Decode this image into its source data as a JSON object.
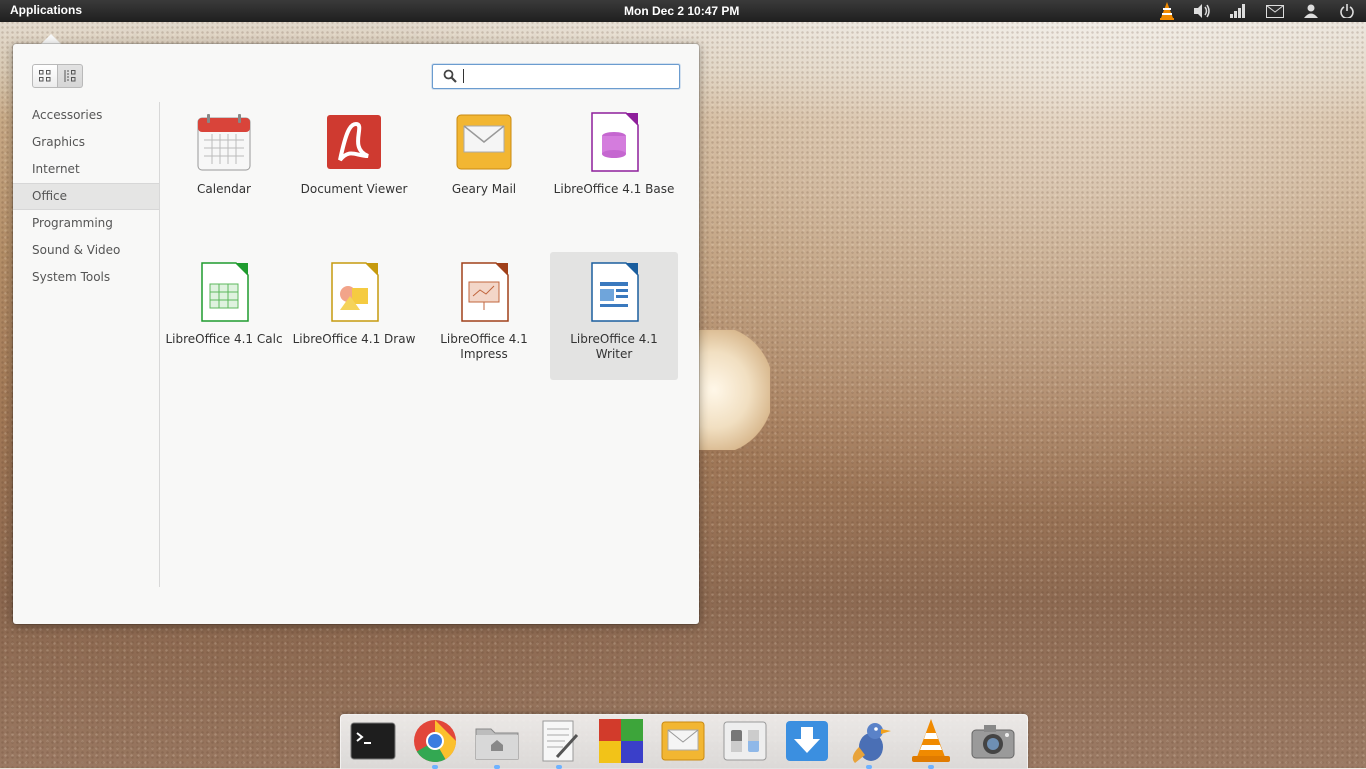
{
  "top_panel": {
    "applications_label": "Applications",
    "clock": "Mon Dec  2 10:47 PM",
    "indicators": [
      "vlc-icon",
      "volume-icon",
      "network-icon",
      "mail-icon",
      "user-icon",
      "power-icon"
    ]
  },
  "menu": {
    "search_placeholder": "",
    "search_value": "",
    "categories": [
      {
        "label": "Accessories",
        "selected": false
      },
      {
        "label": "Graphics",
        "selected": false
      },
      {
        "label": "Internet",
        "selected": false
      },
      {
        "label": "Office",
        "selected": true
      },
      {
        "label": "Programming",
        "selected": false
      },
      {
        "label": "Sound & Video",
        "selected": false
      },
      {
        "label": "System Tools",
        "selected": false
      }
    ],
    "apps": [
      {
        "label": "Calendar",
        "icon": "calendar-icon"
      },
      {
        "label": "Document Viewer",
        "icon": "document-viewer-icon"
      },
      {
        "label": "Geary Mail",
        "icon": "mail-icon"
      },
      {
        "label": "LibreOffice 4.1 Base",
        "icon": "libreoffice-base-icon"
      },
      {
        "label": "LibreOffice 4.1 Calc",
        "icon": "libreoffice-calc-icon"
      },
      {
        "label": "LibreOffice 4.1 Draw",
        "icon": "libreoffice-draw-icon"
      },
      {
        "label": "LibreOffice 4.1 Impress",
        "icon": "libreoffice-impress-icon"
      },
      {
        "label": "LibreOffice 4.1 Writer",
        "icon": "libreoffice-writer-icon",
        "selected": true
      }
    ]
  },
  "dock": {
    "items": [
      "terminal-icon",
      "chrome-icon",
      "files-icon",
      "text-editor-icon",
      "software-center-icon",
      "mail-icon",
      "system-settings-icon",
      "downloads-icon",
      "pidgin-icon",
      "vlc-icon",
      "camera-icon"
    ]
  }
}
